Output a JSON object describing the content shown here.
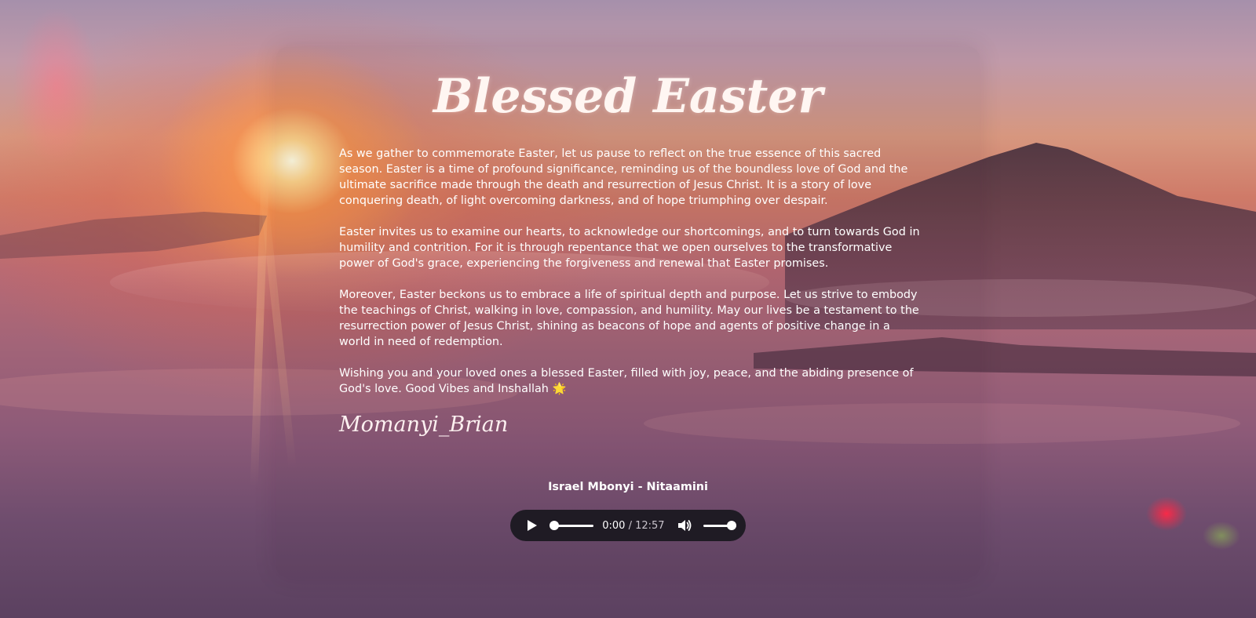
{
  "page": {
    "title": "Blessed Easter",
    "paragraphs": [
      "As we gather to commemorate Easter, let us pause to reflect on the true essence of this sacred season. Easter is a time of profound significance, reminding us of the boundless love of God and the ultimate sacrifice made through the death and resurrection of Jesus Christ. It is a story of love conquering death, of light overcoming darkness, and of hope triumphing over despair.",
      "Easter invites us to examine our hearts, to acknowledge our shortcomings, and to turn towards God in humility and contrition. For it is through repentance that we open ourselves to the transformative power of God's grace, experiencing the forgiveness and renewal that Easter promises.",
      "Moreover, Easter beckons us to embrace a life of spiritual depth and purpose. Let us strive to embody the teachings of Christ, walking in love, compassion, and humility. May our lives be a testament to the resurrection power of Jesus Christ, shining as beacons of hope and agents of positive change in a world in need of redemption.",
      "Wishing you and your loved ones a blessed Easter, filled with joy, peace, and the abiding presence of God's love. Good Vibes and Inshallah 🌟"
    ],
    "signature": "Momanyi_Brian"
  },
  "audio": {
    "song_title": "Israel Mbonyi - Nitaamini",
    "current_time": "0:00",
    "duration": "12:57",
    "progress": 0.0,
    "volume": 1.0,
    "play_icon": "play-icon",
    "volume_icon": "speaker-icon"
  },
  "colors": {
    "text": "#ffffff",
    "player_bg": "#1f1b24"
  }
}
